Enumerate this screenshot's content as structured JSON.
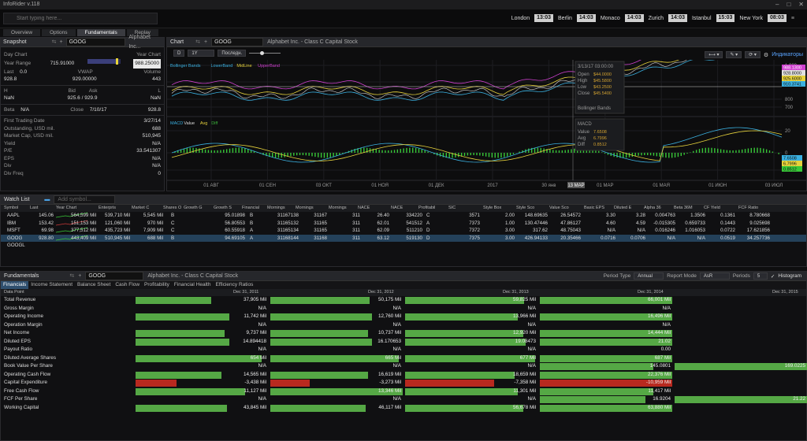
{
  "window": {
    "title": "InfoRider v.118"
  },
  "search": {
    "placeholder": "Start typing here..."
  },
  "clocks": [
    {
      "city": "London",
      "time": "13:03"
    },
    {
      "city": "Berlin",
      "time": "14:03"
    },
    {
      "city": "Monaco",
      "time": "14:03"
    },
    {
      "city": "Zurich",
      "time": "14:03"
    },
    {
      "city": "Istanbul",
      "time": "15:03"
    },
    {
      "city": "New York",
      "time": "08:03"
    }
  ],
  "tabs": [
    "Overview",
    "Options",
    "Fundamentals",
    "Replay"
  ],
  "snapshot": {
    "title": "Snapshot",
    "symbol": "GOOG",
    "company": "Alphabet Inc...",
    "day_chart": "Day Chart",
    "year_chart": "Year Chart",
    "year_range_label": "Year Range",
    "year_low": "715.91000",
    "year_high": "988.25000",
    "last_label": "Last",
    "last_change": "0.0",
    "vwap_label": "VWAP",
    "volume_label": "Volume",
    "last_value": "928.8",
    "vwap_value": "929.00000",
    "volume_value": "443",
    "h_label": "H",
    "bid_label": "Bid",
    "ask_label": "Ask",
    "l_label": "L",
    "h_value": "NaN",
    "bid_ask": "925.6 / 929.9",
    "l_value": "NaN",
    "beta_label": "Beta",
    "beta_value": "N/A",
    "close_label": "Close",
    "close_date": "7/10/17",
    "close_value": "928.8",
    "fields": [
      {
        "label": "First Trading Date",
        "value": "3/27/14"
      },
      {
        "label": "Outstanding, USD mil.",
        "value": "688"
      },
      {
        "label": "Market Cap, USD mil.",
        "value": "510,945"
      },
      {
        "label": "Yield",
        "value": "N/A"
      },
      {
        "label": "P/E",
        "value": "33.541307"
      },
      {
        "label": "EPS",
        "value": "N/A"
      },
      {
        "label": "Div",
        "value": "N/A"
      },
      {
        "label": "Div Freq",
        "value": "0"
      }
    ]
  },
  "chart": {
    "title": "Chart",
    "symbol": "GOOG",
    "company": "Alphabet Inc. - Class C Capital Stock",
    "period": "D",
    "range": "1Y",
    "mode": "Последн.",
    "indicators_label": "Индикаторы",
    "bb_legend": [
      "Bollinger Bands",
      "LowerBand",
      "MidLine",
      "UpperBand"
    ],
    "macd_legend": [
      "MACD",
      "Value",
      "Avg",
      "Diff"
    ],
    "x_ticks": [
      "01 АВГ",
      "01 СЕН",
      "03 ОКТ",
      "01 НОЯ",
      "01 ДЕК",
      "2017",
      "30 янв",
      "01 МАР",
      "01 МАЯ",
      "01 ИЮН",
      "03 ИЮЛ"
    ],
    "x_highlight": "13 МАР",
    "y_ticks_top": [
      "1,000",
      "900",
      "800",
      "700"
    ],
    "y_ticks_bottom": [
      "20",
      "0",
      "-20"
    ],
    "price_labels": [
      "988.1300",
      "928.8000",
      "925.6000",
      "910.3741"
    ],
    "macd_labels": [
      "7.6508",
      "6.7996",
      "0.8512"
    ],
    "tooltip": {
      "date": "3/13/17 03:00:00",
      "rows": [
        [
          "Open",
          "$44.0000"
        ],
        [
          "High",
          "$45.5800"
        ],
        [
          "Low",
          "$43.2500"
        ],
        [
          "Close",
          "$45.5400"
        ]
      ],
      "footer": "Bollinger Bands"
    },
    "tooltip2": {
      "title": "MACD",
      "rows": [
        [
          "Value",
          "7.6508"
        ],
        [
          "Avg",
          "6.7996"
        ],
        [
          "Diff",
          "0.8512"
        ]
      ]
    }
  },
  "watchlist": {
    "title": "Watch List",
    "add_placeholder": "Add symbol...",
    "columns": [
      "Symbol",
      "Last",
      "Year Chart",
      "Enterpris",
      "Market C",
      "Shares O",
      "Growth G",
      "Growth S",
      "Financial",
      "Mornings",
      "Mornings",
      "Mornings",
      "NACE",
      "NACE",
      "Profitabil",
      "SIC",
      "Style Box",
      "Style Sco",
      "Value Sco",
      "Basic EPS",
      "Diluted E",
      "Alpha 36",
      "Beta 36M",
      "CF Yield",
      "FCF Ratio"
    ],
    "rows": [
      [
        "AAPL",
        "145.06",
        "",
        "564,599 Mil",
        "539,710 Mil",
        "5,545 Mil",
        "B",
        "",
        "95.01898",
        "B",
        "31167138",
        "31167",
        "311",
        "26.40",
        "334220",
        "C",
        "3571",
        "2.00",
        "148.69635",
        "26.54572",
        "3.30",
        "3.28",
        "0.004763",
        "1.3506",
        "0.1361",
        "8.780668"
      ],
      [
        "IBM",
        "153.42",
        "",
        "151,153 Mil",
        "121,060 Mil",
        "970 Mil",
        "C",
        "",
        "56.80553",
        "B",
        "31165132",
        "31165",
        "311",
        "62.01",
        "541512",
        "A",
        "7373",
        "1.00",
        "130.47446",
        "47.86127",
        "4.60",
        "4.59",
        "-0.015305",
        "0.659733",
        "0.1443",
        "9.025698"
      ],
      [
        "MSFT",
        "69.98",
        "",
        "377,512 Mil",
        "435,723 Mil",
        "7,909 Mil",
        "C",
        "",
        "60.55918",
        "A",
        "31165134",
        "31165",
        "311",
        "62.09",
        "511210",
        "D",
        "7372",
        "3.00",
        "317.62",
        "48.75043",
        "N/A",
        "N/A",
        "0.016246",
        "1.016053",
        "0.0722",
        "17.621856"
      ],
      [
        "GOOG",
        "928.80",
        "",
        "443,409 Mil",
        "510,945 Mil",
        "688 Mil",
        "B",
        "",
        "94.69105",
        "A",
        "31168144",
        "31168",
        "311",
        "63.12",
        "519130",
        "D",
        "7375",
        "3.00",
        "426.94133",
        "20.35466",
        "0.0716",
        "0.0706",
        "N/A",
        "N/A",
        "0.0519",
        "34.257736"
      ],
      [
        "GOOGL",
        "",
        "",
        "",
        "",
        "",
        "",
        "",
        "",
        "",
        "",
        "",
        "",
        "",
        "",
        "",
        "",
        "",
        "",
        "",
        "",
        "",
        "",
        "",
        "",
        ""
      ]
    ]
  },
  "fundamentals": {
    "title": "Fundamentals",
    "symbol": "GOOG",
    "company": "Alphabet Inc. - Class C Capital Stock",
    "period_type_label": "Period Type",
    "period_type": "Annual",
    "report_mode_label": "Report Mode",
    "report_mode": "AsR",
    "periods_label": "Periods",
    "periods": "5",
    "histogram_label": "Histogram",
    "subtabs": [
      "Financials",
      "Income Statement",
      "Balance Sheet",
      "Cash Flow",
      "Profitability",
      "Financial Health",
      "Efficiency Ratios"
    ],
    "col_header": "Data Point",
    "years": [
      "Dec 31, 2011",
      "Dec 31, 2012",
      "Dec 31, 2013",
      "Dec 31, 2014",
      "Dec 31, 2015"
    ],
    "rows": [
      {
        "name": "Total Revenue",
        "vals": [
          "37,905 Mil",
          "50,175 Mil",
          "59,825 Mil",
          "66,001 Mil",
          ""
        ],
        "fill": [
          0.57,
          0.75,
          0.9,
          1,
          0
        ],
        "neg": [
          0,
          0,
          0,
          0,
          0
        ]
      },
      {
        "name": "Gross Margin",
        "vals": [
          "N/A",
          "N/A",
          "N/A",
          "N/A",
          ""
        ],
        "fill": [
          0,
          0,
          0,
          0,
          0
        ],
        "neg": [
          0,
          0,
          0,
          0,
          0
        ]
      },
      {
        "name": "Operating Income",
        "vals": [
          "11,742 Mil",
          "12,760 Mil",
          "13,966 Mil",
          "16,496 Mil",
          ""
        ],
        "fill": [
          0.71,
          0.77,
          0.85,
          1,
          0
        ],
        "neg": [
          0,
          0,
          0,
          0,
          0
        ]
      },
      {
        "name": "Operation Margin",
        "vals": [
          "N/A",
          "N/A",
          "N/A",
          "N/A",
          ""
        ],
        "fill": [
          0,
          0,
          0,
          0,
          0
        ],
        "neg": [
          0,
          0,
          0,
          0,
          0
        ]
      },
      {
        "name": "Net Income",
        "vals": [
          "9,737 Mil",
          "10,737 Mil",
          "12,920 Mil",
          "14,444 Mil",
          ""
        ],
        "fill": [
          0.67,
          0.74,
          0.89,
          1,
          0
        ],
        "neg": [
          0,
          0,
          0,
          0,
          0
        ]
      },
      {
        "name": "Diluted EPS",
        "vals": [
          "14.894418",
          "16.170653",
          "19.08473",
          "21.02",
          ""
        ],
        "fill": [
          0.71,
          0.77,
          0.91,
          1,
          0
        ],
        "neg": [
          0,
          0,
          0,
          0,
          0
        ]
      },
      {
        "name": "Payout Ratio",
        "vals": [
          "N/A",
          "N/A",
          "N/A",
          "0.00",
          ""
        ],
        "fill": [
          0,
          0,
          0,
          0,
          0
        ],
        "neg": [
          0,
          0,
          0,
          0,
          0
        ]
      },
      {
        "name": "Diluted Average Shares",
        "vals": [
          "654 Mil",
          "665 Mil",
          "677 Mil",
          "687 Mil",
          ""
        ],
        "fill": [
          0.95,
          0.97,
          0.985,
          1,
          0
        ],
        "neg": [
          0,
          0,
          0,
          0,
          0
        ]
      },
      {
        "name": "Book Value Per Share",
        "vals": [
          "N/A",
          "N/A",
          "N/A",
          "145.0801",
          "169.0225"
        ],
        "fill": [
          0,
          0,
          0,
          0.86,
          1
        ],
        "neg": [
          0,
          0,
          0,
          0,
          0
        ]
      },
      {
        "name": "Operating Cash Flow",
        "vals": [
          "14,565 Mil",
          "16,619 Mil",
          "18,659 Mil",
          "22,376 Mil",
          ""
        ],
        "fill": [
          0.65,
          0.74,
          0.83,
          1,
          0
        ],
        "neg": [
          0,
          0,
          0,
          0,
          0
        ]
      },
      {
        "name": "Capital Expenditure",
        "vals": [
          "-3,438 Mil",
          "-3,273 Mil",
          "-7,358 Mil",
          "-10,959 Mil",
          ""
        ],
        "fill": [
          0.31,
          0.3,
          0.67,
          1,
          0
        ],
        "neg": [
          1,
          1,
          1,
          1,
          0
        ]
      },
      {
        "name": "Free Cash Flow",
        "vals": [
          "11,127 Mil",
          "13,346 Mil",
          "11,301 Mil",
          "11,417 Mil",
          ""
        ],
        "fill": [
          0.83,
          1,
          0.85,
          0.86,
          0
        ],
        "neg": [
          0,
          0,
          0,
          0,
          0
        ]
      },
      {
        "name": "FCF Per Share",
        "vals": [
          "N/A",
          "N/A",
          "N/A",
          "16.9204",
          "21.22"
        ],
        "fill": [
          0,
          0,
          0,
          0.8,
          1
        ],
        "neg": [
          0,
          0,
          0,
          0,
          0
        ]
      },
      {
        "name": "Working Capital",
        "vals": [
          "43,845 Mil",
          "46,117 Mil",
          "56,678 Mil",
          "63,880 Mil",
          ""
        ],
        "fill": [
          0.69,
          0.72,
          0.89,
          1,
          0
        ],
        "neg": [
          0,
          0,
          0,
          0,
          0
        ]
      }
    ]
  }
}
